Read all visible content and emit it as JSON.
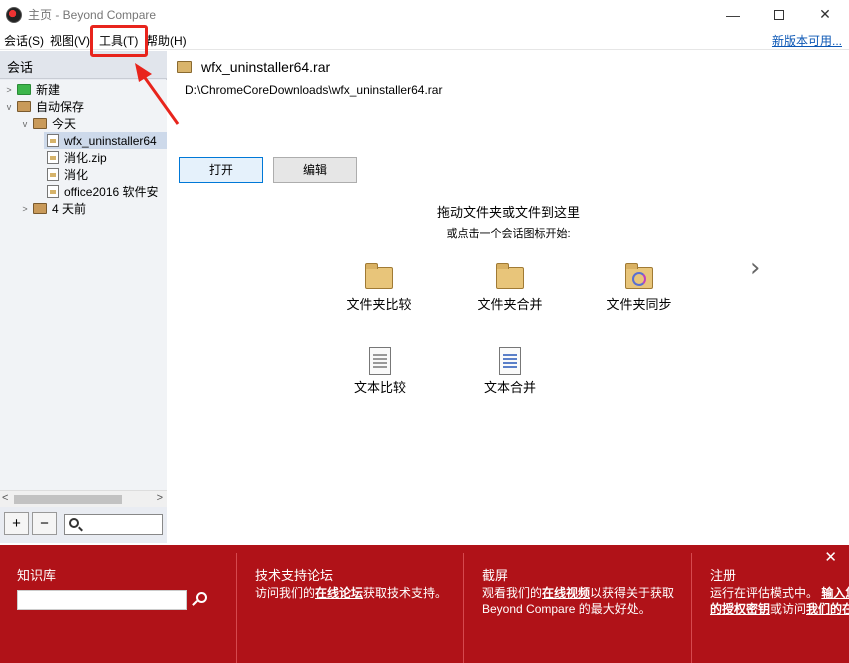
{
  "window": {
    "title": "主页 - Beyond Compare",
    "min": "—",
    "close": "✕"
  },
  "menu": {
    "items": [
      "会话(S)",
      "视图(V)",
      "工具(T)",
      "帮助(H)"
    ],
    "update_link": "新版本可用..."
  },
  "sidebar": {
    "header": "会话",
    "tree": [
      {
        "label": "新建",
        "icon": "green-square-icon",
        "level": 0,
        "expander": "collapsed"
      },
      {
        "label": "自动保存",
        "icon": "box-icon",
        "level": 0,
        "expander": "expanded"
      },
      {
        "label": "今天",
        "icon": "box-icon",
        "level": 1,
        "expander": "expanded"
      },
      {
        "label": "wfx_uninstaller64",
        "icon": "file-icon",
        "level": 2,
        "selected": true
      },
      {
        "label": "消化.zip",
        "icon": "file-icon",
        "level": 2
      },
      {
        "label": "消化",
        "icon": "file-icon",
        "level": 2
      },
      {
        "label": "office2016 软件安",
        "icon": "file-icon",
        "level": 2
      },
      {
        "label": "4 天前",
        "icon": "box-icon",
        "level": 1,
        "expander": "collapsed"
      }
    ],
    "add_label": "+",
    "remove_label": "−",
    "search_placeholder": ""
  },
  "main": {
    "file_name": "wfx_uninstaller64.rar",
    "file_path": "D:\\ChromeCoreDownloads\\wfx_uninstaller64.rar",
    "open_label": "打开",
    "edit_label": "编辑",
    "drop_hint": "拖动文件夹或文件到这里",
    "drop_sub": "或点击一个会话图标开始:",
    "tiles": [
      {
        "label": "文件夹比较",
        "icon": "folder-compare-icon"
      },
      {
        "label": "文件夹合并",
        "icon": "folder-merge-icon"
      },
      {
        "label": "文件夹同步",
        "icon": "folder-sync-icon"
      },
      {
        "label": "文本比较",
        "icon": "text-compare-icon"
      },
      {
        "label": "文本合并",
        "icon": "text-merge-icon"
      }
    ]
  },
  "banner": {
    "close": "✕",
    "kb_title": "知识库",
    "forum_title": "技术支持论坛",
    "forum_text_pre": "访问我们的",
    "forum_link": "在线论坛",
    "forum_text_post": "获取技术支持。",
    "video_title": "截屏",
    "video_line1_pre": "观看我们的",
    "video_link": "在线视频",
    "video_line1_post": "以获得关于获取",
    "video_line2": "Beyond Compare 的最大好处。",
    "reg_title": "注册",
    "reg_line1_pre": "运行在评估模式中。",
    "reg_line1_link": "输入您",
    "reg_line2_link": "的授权密钥",
    "reg_line2_mid": "或访问",
    "reg_line2_link2": "我们的在"
  },
  "colors": {
    "banner": "#b01218",
    "annotation": "#e8241c",
    "link": "#0b57b5"
  }
}
